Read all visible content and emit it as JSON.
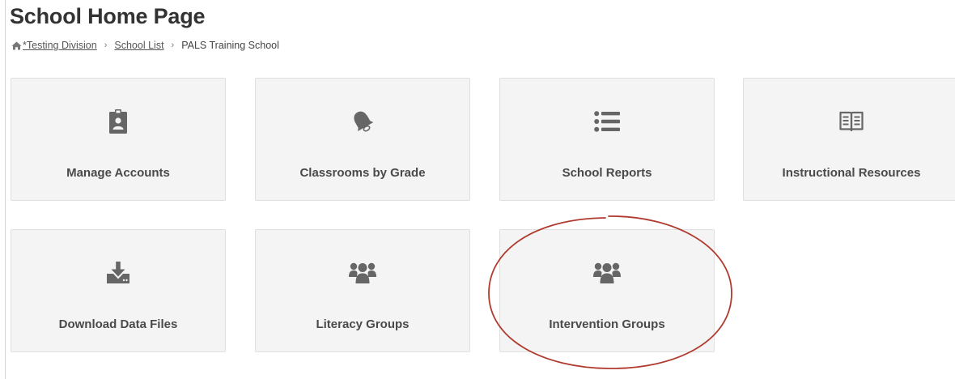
{
  "page": {
    "title": "School Home Page"
  },
  "breadcrumb": {
    "items": [
      {
        "label": "*Testing Division",
        "link": true
      },
      {
        "label": "School List",
        "link": true
      },
      {
        "label": "PALS Training School",
        "link": false
      }
    ],
    "separator": "›"
  },
  "tiles": [
    {
      "label": "Manage Accounts",
      "icon": "id-badge-icon"
    },
    {
      "label": "Classrooms by Grade",
      "icon": "bell-icon"
    },
    {
      "label": "School Reports",
      "icon": "list-icon"
    },
    {
      "label": "Instructional Resources",
      "icon": "book-icon"
    },
    {
      "label": "Download Data Files",
      "icon": "download-icon"
    },
    {
      "label": "Literacy Groups",
      "icon": "users-icon"
    },
    {
      "label": "Intervention Groups",
      "icon": "users-icon"
    }
  ],
  "annotation": {
    "highlighted_tile": "Intervention Groups",
    "color": "#b03a2e"
  },
  "colors": {
    "tile_background": "#f4f4f4",
    "icon": "#666666",
    "text": "#333333"
  }
}
